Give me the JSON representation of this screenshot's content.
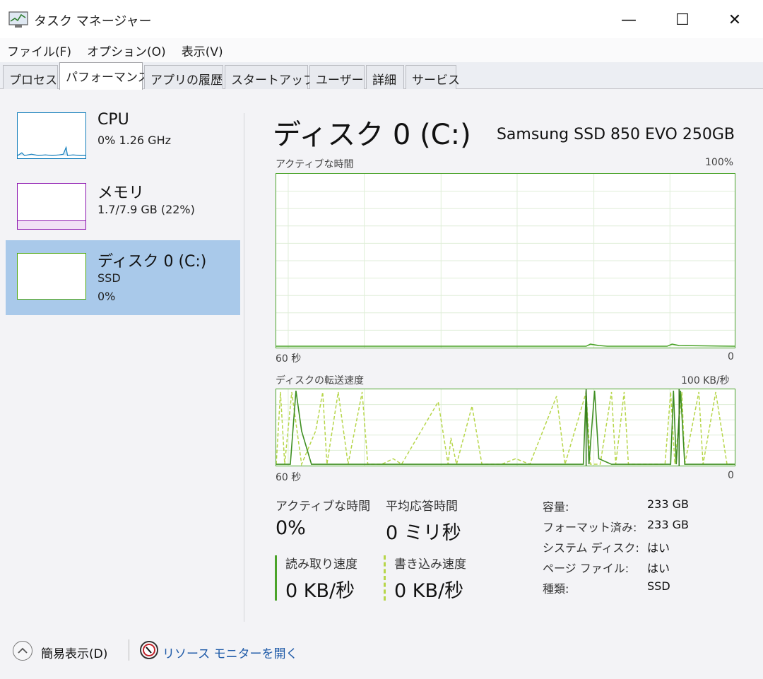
{
  "window": {
    "title": "タスク マネージャー",
    "minimize_glyph": "—",
    "maximize_glyph": "☐",
    "close_glyph": "✕"
  },
  "menu": [
    "ファイル(F)",
    "オプション(O)",
    "表示(V)"
  ],
  "tabs": [
    {
      "label": "プロセス",
      "active": false
    },
    {
      "label": "パフォーマンス",
      "active": true
    },
    {
      "label": "アプリの履歴",
      "active": false
    },
    {
      "label": "スタートアップ",
      "active": false
    },
    {
      "label": "ユーザー",
      "active": false
    },
    {
      "label": "詳細",
      "active": false
    },
    {
      "label": "サービス",
      "active": false
    }
  ],
  "sidebar": {
    "items": [
      {
        "title": "CPU",
        "sub1": "0%  1.26 GHz",
        "sub2": "",
        "selected": false,
        "color": "#117dbb"
      },
      {
        "title": "メモリ",
        "sub1": "1.7/7.9 GB (22%)",
        "sub2": "",
        "selected": false,
        "color": "#8b12ae"
      },
      {
        "title": "ディスク 0 (C:)",
        "sub1": "SSD",
        "sub2": "0%",
        "selected": true,
        "color": "#4da60c"
      }
    ]
  },
  "main": {
    "title": "ディスク 0 (C:)",
    "model": "Samsung SSD 850 EVO 250GB",
    "active_graph": {
      "label": "アクティブな時間",
      "max_label": "100%",
      "x_left_label": "60 秒",
      "x_right_label": "0"
    },
    "transfer_graph": {
      "label": "ディスクの転送速度",
      "max_label": "100 KB/秒",
      "x_left_label": "60 秒",
      "x_right_label": "0"
    },
    "stats": {
      "active_time_label": "アクティブな時間",
      "active_time_value": "0%",
      "response_label": "平均応答時間",
      "response_value": "0 ミリ秒",
      "read_label": "読み取り速度",
      "read_value": "0 KB/秒",
      "write_label": "書き込み速度",
      "write_value": "0 KB/秒"
    },
    "info": [
      {
        "label": "容量:",
        "value": "233 GB"
      },
      {
        "label": "フォーマット済み:",
        "value": "233 GB"
      },
      {
        "label": "システム ディスク:",
        "value": "はい"
      },
      {
        "label": "ページ ファイル:",
        "value": "はい"
      },
      {
        "label": "種類:",
        "value": "SSD"
      }
    ]
  },
  "footer": {
    "fewer_details": "簡易表示(D)",
    "resource_monitor": "リソース モニターを開く"
  },
  "colors": {
    "disk_line": "#4aa329",
    "disk_fill": "#e9f5e2",
    "write_line": "#b7d64a",
    "cpu_line": "#117dbb",
    "memory_line": "#8b12ae",
    "selected_bg": "#a9c9ea",
    "link": "#1e5aa8"
  }
}
